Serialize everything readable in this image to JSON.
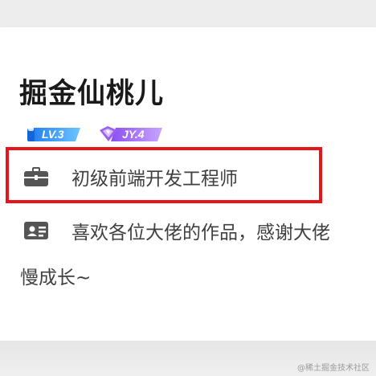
{
  "profile": {
    "name": "掘金仙桃儿",
    "badges": {
      "level": "LV.3",
      "jy": "JY.4"
    },
    "job_title": "初级前端开发工程师",
    "bio_line1": "喜欢各位大佬的作品，感谢大佬",
    "bio_line2": "慢成长~"
  },
  "icons": {
    "job": "briefcase-icon",
    "bio": "id-card-icon"
  },
  "watermark": "@稀土掘金技术社区",
  "colors": {
    "highlight_border": "#e8141b",
    "level_badge": "#2f8ff7",
    "jy_badge": "#9b62f0",
    "name_text": "#1a1a1a",
    "body_text": "#404040"
  }
}
